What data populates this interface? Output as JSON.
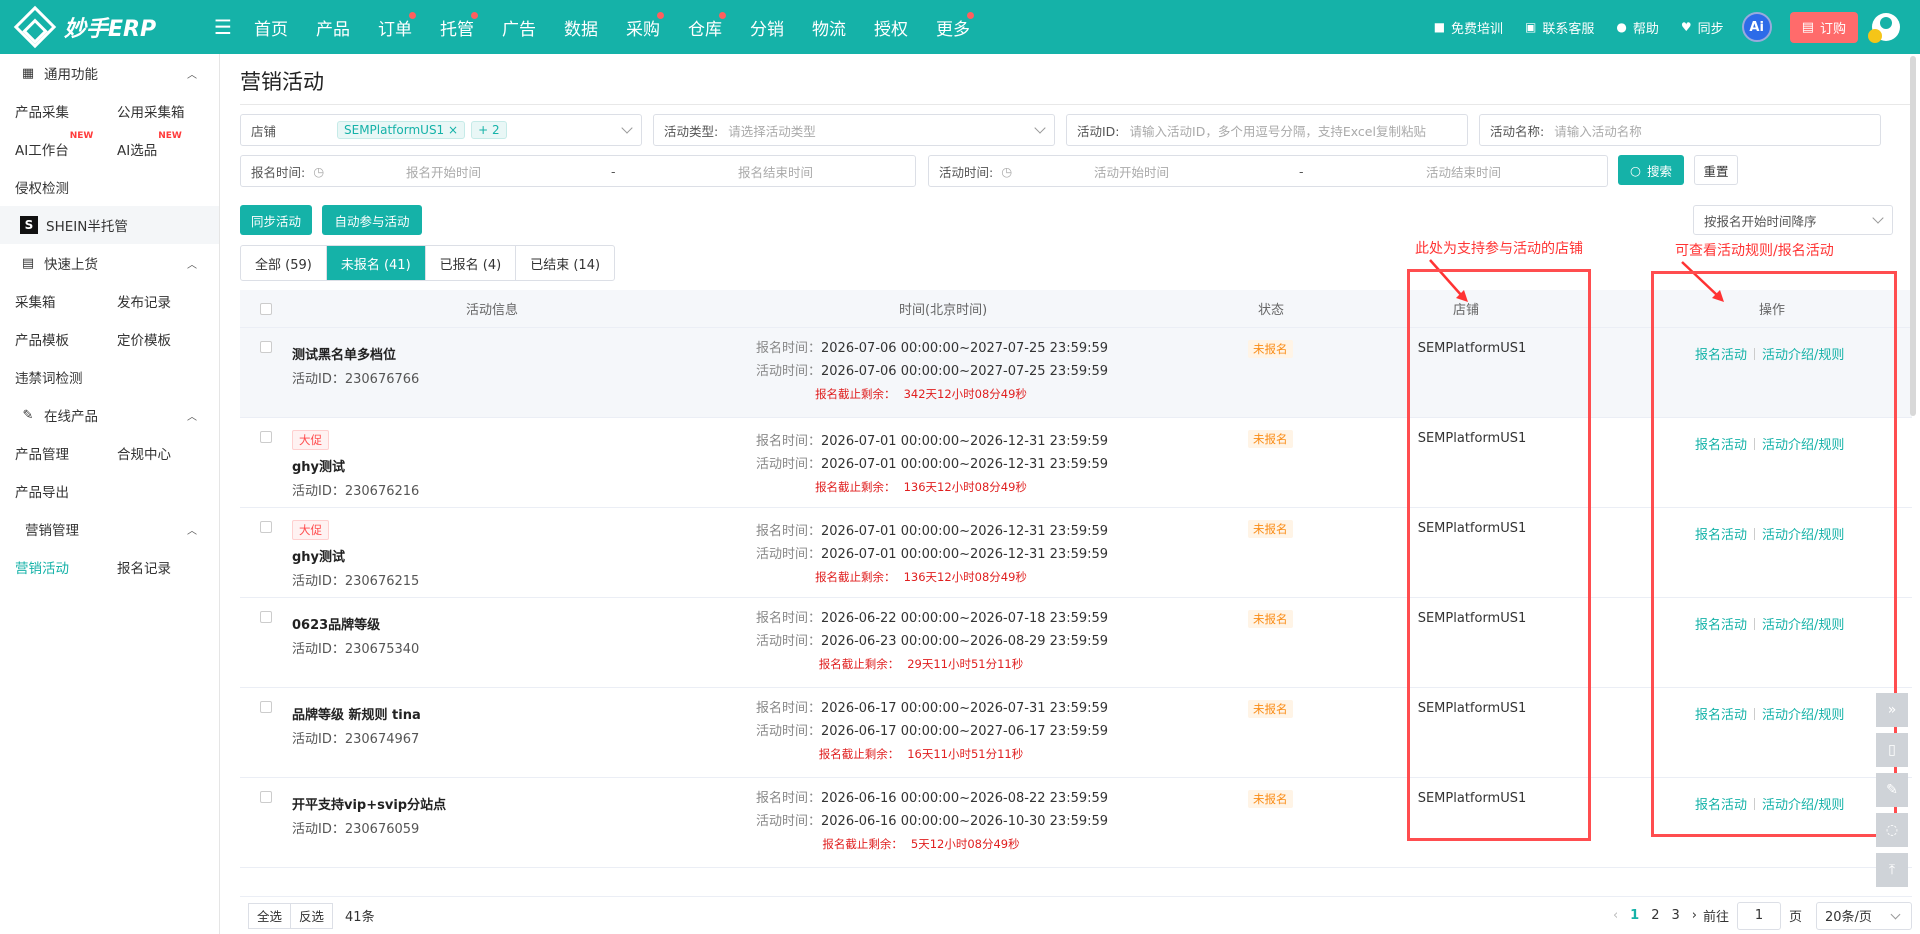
{
  "header": {
    "logo_text": "妙手ERP",
    "nav": [
      {
        "label": "首页",
        "dot": false
      },
      {
        "label": "产品",
        "dot": false
      },
      {
        "label": "订单",
        "dot": true
      },
      {
        "label": "托管",
        "dot": true
      },
      {
        "label": "广告",
        "dot": false
      },
      {
        "label": "数据",
        "dot": false
      },
      {
        "label": "采购",
        "dot": true
      },
      {
        "label": "仓库",
        "dot": true
      },
      {
        "label": "分销",
        "dot": false
      },
      {
        "label": "物流",
        "dot": false
      },
      {
        "label": "授权",
        "dot": false
      },
      {
        "label": "更多",
        "dot": true
      }
    ],
    "right": {
      "training": "免费培训",
      "support": "联系客服",
      "help": "帮助",
      "sync": "同步",
      "ai": "Ai",
      "order": "订购"
    }
  },
  "sidebar": {
    "general": {
      "title": "通用功能",
      "items": [
        "产品采集",
        "公用采集箱",
        "AI工作台",
        "AI选品",
        "侵权检测"
      ],
      "new_badge": "NEW"
    },
    "shein": "SHEIN半托管",
    "quick_list": {
      "title": "快速上货",
      "items": [
        "采集箱",
        "发布记录",
        "产品模板",
        "定价模板",
        "违禁词检测"
      ]
    },
    "online": {
      "title": "在线产品",
      "items": [
        "产品管理",
        "合规中心",
        "产品导出"
      ]
    },
    "marketing": {
      "title": "营销管理",
      "items": [
        "营销活动",
        "报名记录"
      ]
    }
  },
  "page": {
    "title": "营销活动",
    "filters": {
      "shop_label": "店铺",
      "shop_tag": "SEMPlatformUS1",
      "shop_more": "+ 2",
      "type_label": "活动类型:",
      "type_placeholder": "请选择活动类型",
      "id_label": "活动ID:",
      "id_placeholder": "请输入活动ID，多个用逗号分隔，支持Excel复制粘贴",
      "name_label": "活动名称:",
      "name_placeholder": "请输入活动名称",
      "reg_time_label": "报名时间:",
      "reg_start": "报名开始时间",
      "reg_end": "报名结束时间",
      "act_time_label": "活动时间:",
      "act_start": "活动开始时间",
      "act_end": "活动结束时间",
      "dash": "-",
      "search": "搜索",
      "reset": "重置"
    },
    "actions": {
      "sync": "同步活动",
      "auto_join": "自动参与活动",
      "sort": "按报名开始时间降序"
    },
    "tabs": [
      "全部 (59)",
      "未报名 (41)",
      "已报名 (4)",
      "已结束 (14)"
    ],
    "annotations": {
      "shop": "此处为支持参与活动的店铺",
      "ops": "可查看活动规则/报名活动"
    },
    "columns": {
      "info": "活动信息",
      "time": "时间(北京时间)",
      "status": "状态",
      "shop": "店铺",
      "ops": "操作"
    },
    "labels": {
      "reg_prefix": "报名时间：",
      "act_prefix": "活动时间：",
      "id_prefix": "活动ID：",
      "deadline_prefix": "报名截止剩余：",
      "join": "报名活动",
      "rules": "活动介绍/规则"
    },
    "rows": [
      {
        "tag": "",
        "name": "测试黑名单多档位",
        "id": "230676766",
        "reg": "2026-07-06 00:00:00~2027-07-25 23:59:59",
        "act": "2026-07-06 00:00:00~2027-07-25 23:59:59",
        "deadline": "342天12小时08分49秒",
        "status": "未报名",
        "shop": "SEMPlatformUS1"
      },
      {
        "tag": "大促",
        "name": "ghy测试",
        "id": "230676216",
        "reg": "2026-07-01 00:00:00~2026-12-31 23:59:59",
        "act": "2026-07-01 00:00:00~2026-12-31 23:59:59",
        "deadline": "136天12小时08分49秒",
        "status": "未报名",
        "shop": "SEMPlatformUS1"
      },
      {
        "tag": "大促",
        "name": "ghy测试",
        "id": "230676215",
        "reg": "2026-07-01 00:00:00~2026-12-31 23:59:59",
        "act": "2026-07-01 00:00:00~2026-12-31 23:59:59",
        "deadline": "136天12小时08分49秒",
        "status": "未报名",
        "shop": "SEMPlatformUS1"
      },
      {
        "tag": "",
        "name": "0623品牌等级",
        "id": "230675340",
        "reg": "2026-06-22 00:00:00~2026-07-18 23:59:59",
        "act": "2026-06-23 00:00:00~2026-08-29 23:59:59",
        "deadline": "29天11小时51分11秒",
        "status": "未报名",
        "shop": "SEMPlatformUS1"
      },
      {
        "tag": "",
        "name": "品牌等级 新规则 tina",
        "id": "230674967",
        "reg": "2026-06-17 00:00:00~2026-07-31 23:59:59",
        "act": "2026-06-17 00:00:00~2027-06-17 23:59:59",
        "deadline": "16天11小时51分11秒",
        "status": "未报名",
        "shop": "SEMPlatformUS1"
      },
      {
        "tag": "",
        "name": "开平支持vip+svip分站点",
        "id": "230676059",
        "reg": "2026-06-16 00:00:00~2026-08-22 23:59:59",
        "act": "2026-06-16 00:00:00~2026-10-30 23:59:59",
        "deadline": "5天12小时08分49秒",
        "status": "未报名",
        "shop": "SEMPlatformUS1"
      }
    ],
    "footer": {
      "select_all": "全选",
      "invert": "反选",
      "count": "41条",
      "pages": [
        "1",
        "2",
        "3"
      ],
      "goto": "前往",
      "page_value": "1",
      "page_unit": "页",
      "page_size": "20条/页"
    }
  }
}
